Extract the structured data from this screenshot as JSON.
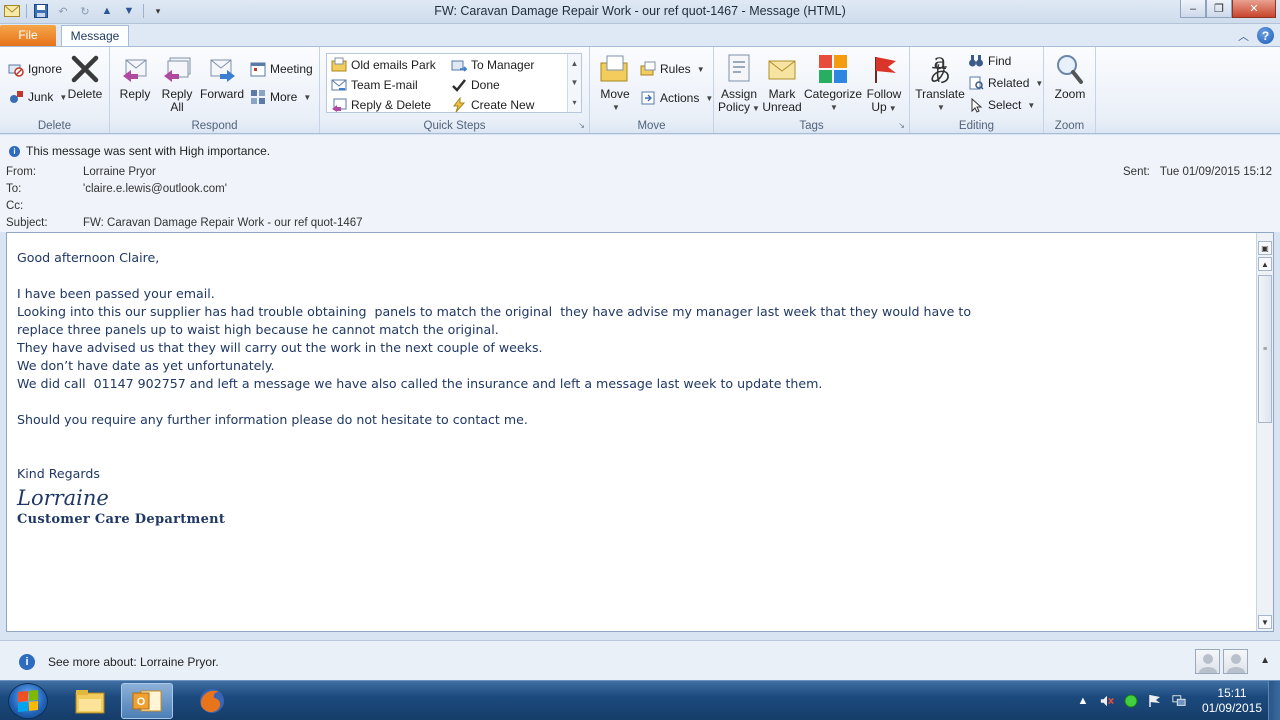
{
  "window": {
    "title": "FW: Caravan Damage Repair Work -  our ref  quot-1467  - Message (HTML)"
  },
  "tabs": {
    "file": "File",
    "message": "Message"
  },
  "ribbon": {
    "delete_group": {
      "label": "Delete",
      "ignore": "Ignore",
      "junk": "Junk",
      "delete": "Delete"
    },
    "respond_group": {
      "label": "Respond",
      "reply": "Reply",
      "reply_all_1": "Reply",
      "reply_all_2": "All",
      "forward": "Forward",
      "meeting": "Meeting",
      "more": "More"
    },
    "quick_steps": {
      "label": "Quick Steps",
      "items": [
        "Old emails Park",
        "To Manager",
        "Team E-mail",
        "Done",
        "Reply & Delete",
        "Create New"
      ]
    },
    "move_group": {
      "label": "Move",
      "move": "Move",
      "rules": "Rules",
      "actions": "Actions"
    },
    "tags_group": {
      "label": "Tags",
      "assign_1": "Assign",
      "assign_2": "Policy",
      "mark_1": "Mark",
      "mark_2": "Unread",
      "categorize": "Categorize",
      "follow_1": "Follow",
      "follow_2": "Up"
    },
    "editing_group": {
      "label": "Editing",
      "translate": "Translate",
      "find": "Find",
      "related": "Related",
      "select": "Select"
    },
    "zoom_group": {
      "label": "Zoom",
      "zoom": "Zoom"
    }
  },
  "header": {
    "importance": "This message was sent with High importance.",
    "from_label": "From:",
    "from": "Lorraine Pryor",
    "to_label": "To:",
    "to": "'claire.e.lewis@outlook.com'",
    "cc_label": "Cc:",
    "cc": "",
    "subject_label": "Subject:",
    "subject": "FW: Caravan Damage Repair Work -  our ref  quot-1467",
    "sent_label": "Sent:",
    "sent": "Tue 01/09/2015 15:12"
  },
  "body": {
    "greeting": "Good afternoon Claire,",
    "line1": "I have been passed your email.",
    "line2": "Looking into this our supplier has had trouble obtaining  panels to match the original  they have advise my manager last week that they would have to",
    "line3": "replace three panels up to waist high because he cannot match the original.",
    "line4": "They have advised us that they will carry out the work in the next couple of weeks.",
    "line5": "We don’t have date as yet unfortunately.",
    "line6": "We did call  01147 902757 and left a message we have also called the insurance and left a message last week to update them.",
    "line7": "Should you require any further information please do not hesitate to contact me.",
    "regards": "Kind Regards",
    "signature_name": "Lorraine",
    "signature_dept": "Customer Care Department"
  },
  "people_pane": {
    "text": "See more about: Lorraine Pryor."
  },
  "taskbar": {
    "time": "15:11",
    "date": "01/09/2015"
  },
  "colors": {
    "file_tab": "#e6731a",
    "body_text": "#1f3864",
    "taskbar": "#1c4a7e"
  }
}
